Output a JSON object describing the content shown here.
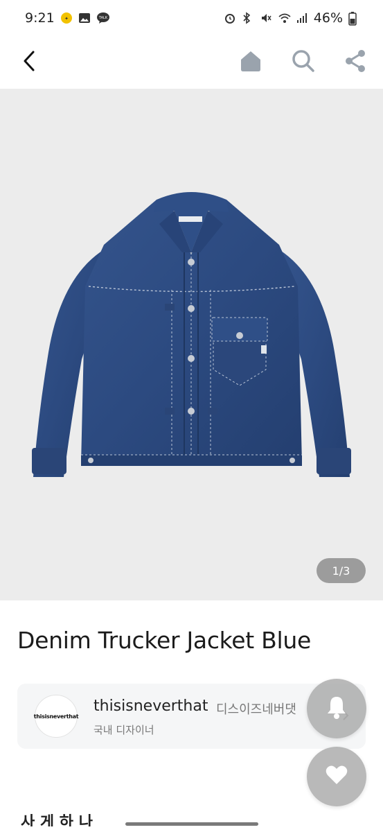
{
  "status_bar": {
    "time": "9:21",
    "battery": "46%",
    "left_icons": [
      "promo-app-icon",
      "gallery-icon",
      "talk-icon"
    ],
    "right_icons": [
      "alarm-icon",
      "bluetooth-icon",
      "mute-icon",
      "wifi-icon",
      "signal-icon",
      "battery-icon"
    ]
  },
  "nav": {
    "icons": [
      "back-arrow-icon",
      "home-icon",
      "search-icon",
      "share-icon"
    ]
  },
  "gallery": {
    "counter": "1/3",
    "image_subject": "denim-trucker-jacket-image"
  },
  "product": {
    "title": "Denim Trucker Jacket Blue"
  },
  "brand": {
    "logo_text": "thisisneverthat",
    "name_en": "thisisneverthat",
    "name_ko": "디스이즈네버댓",
    "category": "국내 디자이너"
  },
  "fabs": {
    "icons": [
      "bell-icon",
      "heart-icon"
    ]
  },
  "section": {
    "cutoff_heading": "사 게 하 나"
  },
  "colors": {
    "denim": "#2c4a80",
    "gallery_bg": "#ececec",
    "counter_bg": "#9c9c9c",
    "fab_bg": "#aaaaaa",
    "nav_icon": "#9aa3ad"
  }
}
